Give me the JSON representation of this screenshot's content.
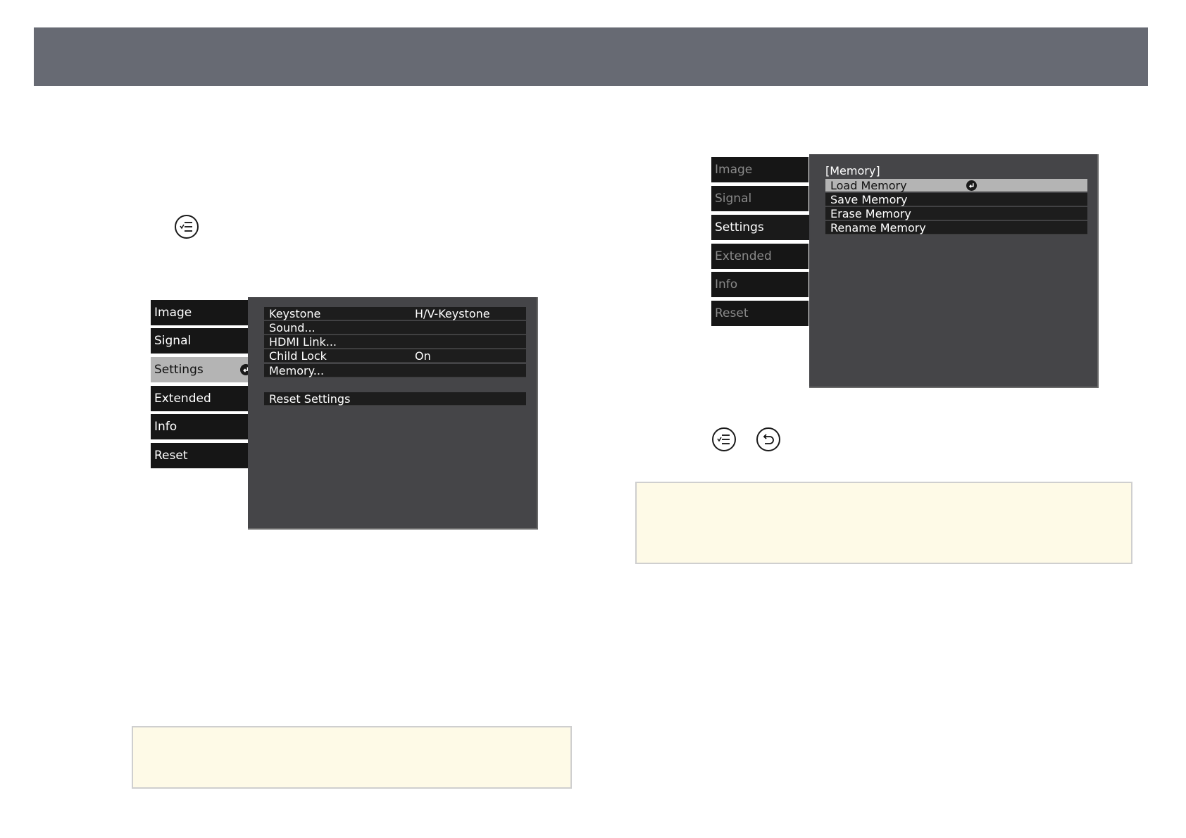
{
  "menu_left": {
    "tabs": [
      {
        "label": "Image"
      },
      {
        "label": "Signal"
      },
      {
        "label": "Settings"
      },
      {
        "label": "Extended"
      },
      {
        "label": "Info"
      },
      {
        "label": "Reset"
      }
    ],
    "selected_tab": "Settings",
    "items": [
      {
        "label": "Keystone",
        "value": "H/V-Keystone"
      },
      {
        "label": "Sound...",
        "value": ""
      },
      {
        "label": "HDMI Link...",
        "value": ""
      },
      {
        "label": "Child Lock",
        "value": "On"
      },
      {
        "label": "Memory...",
        "value": ""
      }
    ],
    "reset_item": "Reset Settings"
  },
  "menu_right": {
    "tabs": [
      {
        "label": "Image"
      },
      {
        "label": "Signal"
      },
      {
        "label": "Settings"
      },
      {
        "label": "Extended"
      },
      {
        "label": "Info"
      },
      {
        "label": "Reset"
      }
    ],
    "selected_tab": "Settings",
    "title": "[Memory]",
    "items": [
      {
        "label": "Load Memory"
      },
      {
        "label": "Save Memory"
      },
      {
        "label": "Erase Memory"
      },
      {
        "label": "Rename Memory"
      }
    ],
    "highlighted_item": "Load Memory"
  },
  "icons": {
    "menu_button": "menu-list-icon",
    "return_button": "return-arrow-icon",
    "enter_indicator": "enter-icon"
  }
}
